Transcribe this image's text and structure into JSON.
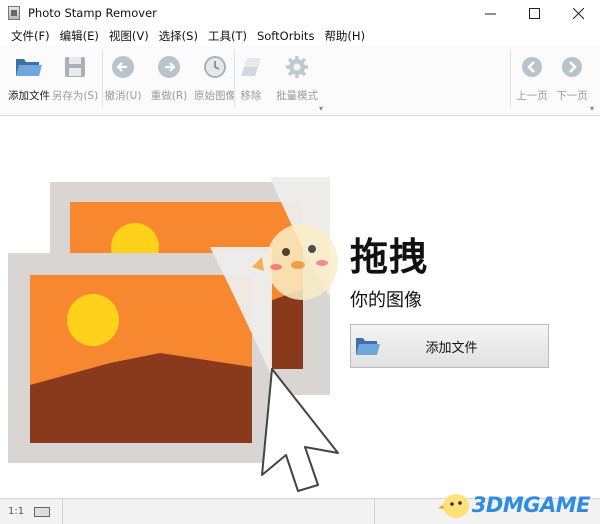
{
  "window": {
    "title": "Photo Stamp Remover"
  },
  "menu": {
    "items": [
      "文件(F)",
      "编辑(E)",
      "视图(V)",
      "选择(S)",
      "工具(T)",
      "SoftOrbits",
      "帮助(H)"
    ]
  },
  "toolbar": {
    "add_file": "添加文件",
    "save_as": "另存为(S)",
    "undo": "撤消(U)",
    "redo": "重做(R)",
    "original": "原始图像",
    "remove": "移除",
    "batch": "批量模式",
    "prev_page": "上一页",
    "next_page": "下一页"
  },
  "main": {
    "drag_title": "拖拽",
    "drag_subtitle": "你的图像",
    "add_file_button": "添加文件"
  },
  "status": {
    "zoom": "1:1"
  },
  "watermark": {
    "text": "3DMGAME"
  },
  "colors": {
    "orange": "#f7882f",
    "sun": "#ffd11a",
    "mountain": "#8a3a1c",
    "frame": "#d9d5d2",
    "accent_blue": "#2e8be0"
  }
}
